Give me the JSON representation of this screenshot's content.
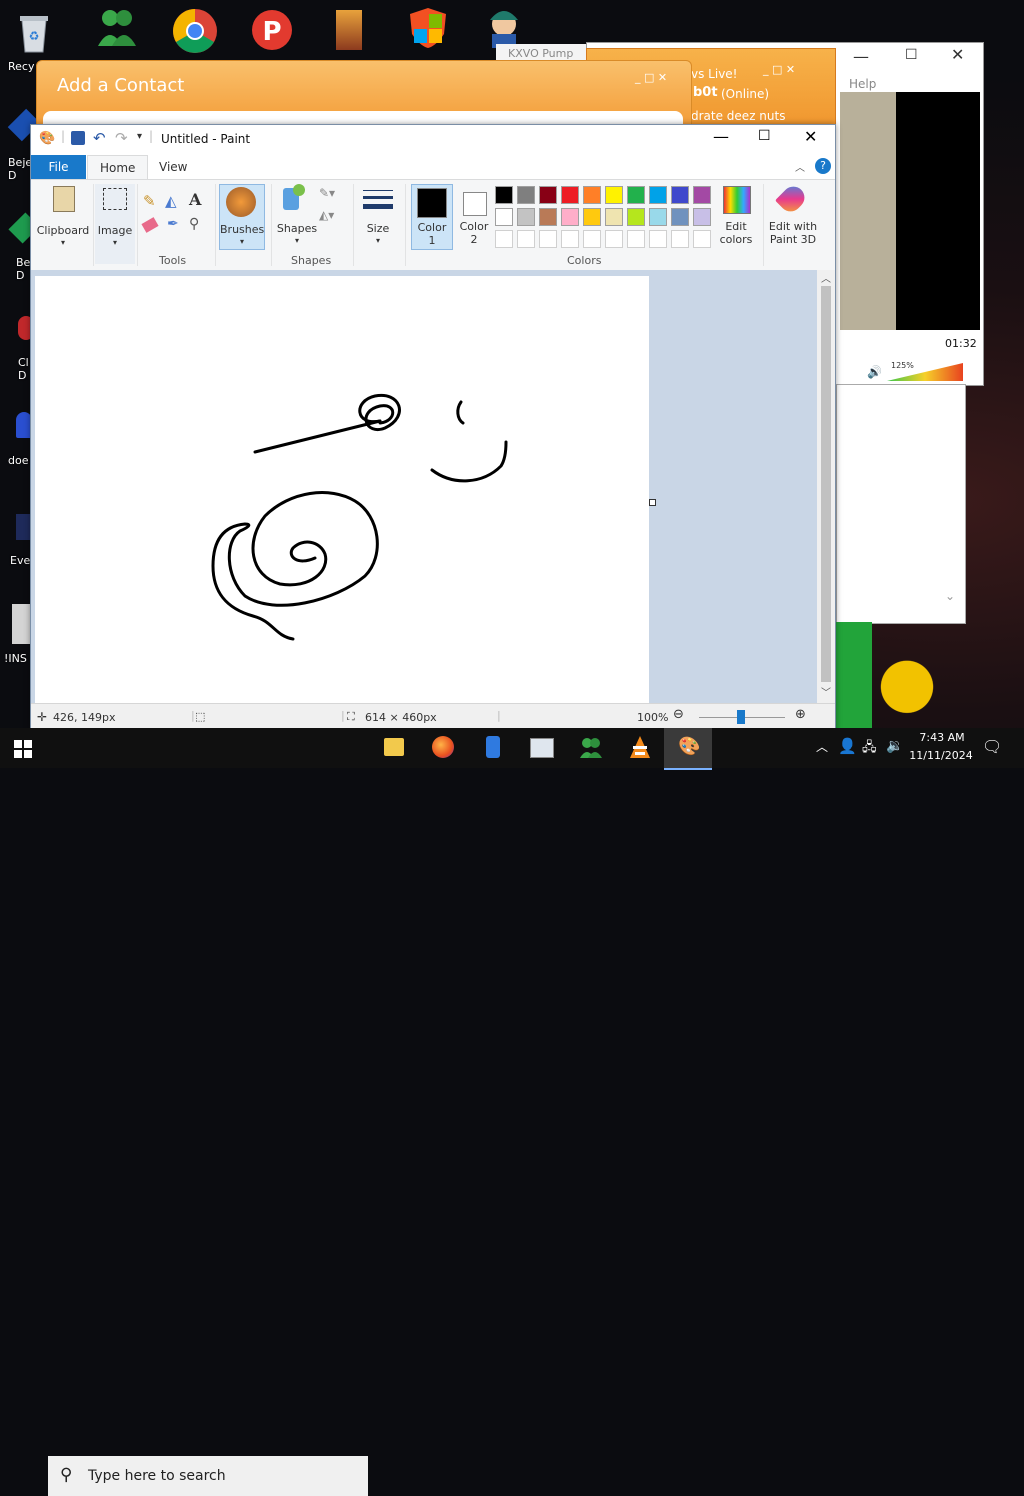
{
  "desktop": {
    "icons": [
      {
        "label": "Recy",
        "icon": "recycle-bin-icon"
      },
      {
        "label": "Beje\nD",
        "icon": "bejeweled-icon"
      },
      {
        "label": "Bej\nD",
        "icon": "bejeweled2-icon"
      },
      {
        "label": "Cl\nD",
        "icon": "app-icon"
      },
      {
        "label": "doe",
        "icon": "app-icon"
      },
      {
        "label": "Eve",
        "icon": "app-icon"
      },
      {
        "label": "!INS",
        "icon": "app-icon"
      }
    ]
  },
  "background_windows": {
    "media": {
      "time": "01:32",
      "volume": "125%",
      "help": "Help"
    },
    "msn": {
      "title_fragment": "vs Live!",
      "user": "b0t",
      "status": "(Online)",
      "message": "drate deez nuts"
    },
    "contact": {
      "title": "Add a Contact"
    },
    "kxvo_tab": "KXVO Pump"
  },
  "paint": {
    "title": "Untitled - Paint",
    "tabs": [
      "File",
      "Home",
      "View"
    ],
    "groups": {
      "clipboard": "Clipboard",
      "image": "Image",
      "tools": "Tools",
      "brushes": "Brushes",
      "shapes_btn": "Shapes",
      "shapes": "Shapes",
      "size": "Size",
      "color1": "Color\n1",
      "color2": "Color\n2",
      "colors": "Colors",
      "edit_colors": "Edit\ncolors",
      "paint3d": "Edit with\nPaint 3D"
    },
    "palette_row1": [
      "#000000",
      "#7f7f7f",
      "#880015",
      "#ed1c24",
      "#ff7f27",
      "#fff200",
      "#22b14c",
      "#00a2e8",
      "#3f48cc",
      "#a349a4"
    ],
    "palette_row2": [
      "#ffffff",
      "#c3c3c3",
      "#b97a57",
      "#ffaec9",
      "#ffc90e",
      "#efe4b0",
      "#b5e61d",
      "#99d9ea",
      "#7092be",
      "#c8bfe7"
    ],
    "status": {
      "cursor": "426, 149px",
      "size": "614 × 460px",
      "zoom": "100%"
    }
  },
  "taskbar": {
    "search_placeholder": "Type here to search",
    "time": "7:43 AM",
    "date": "11/11/2024"
  }
}
